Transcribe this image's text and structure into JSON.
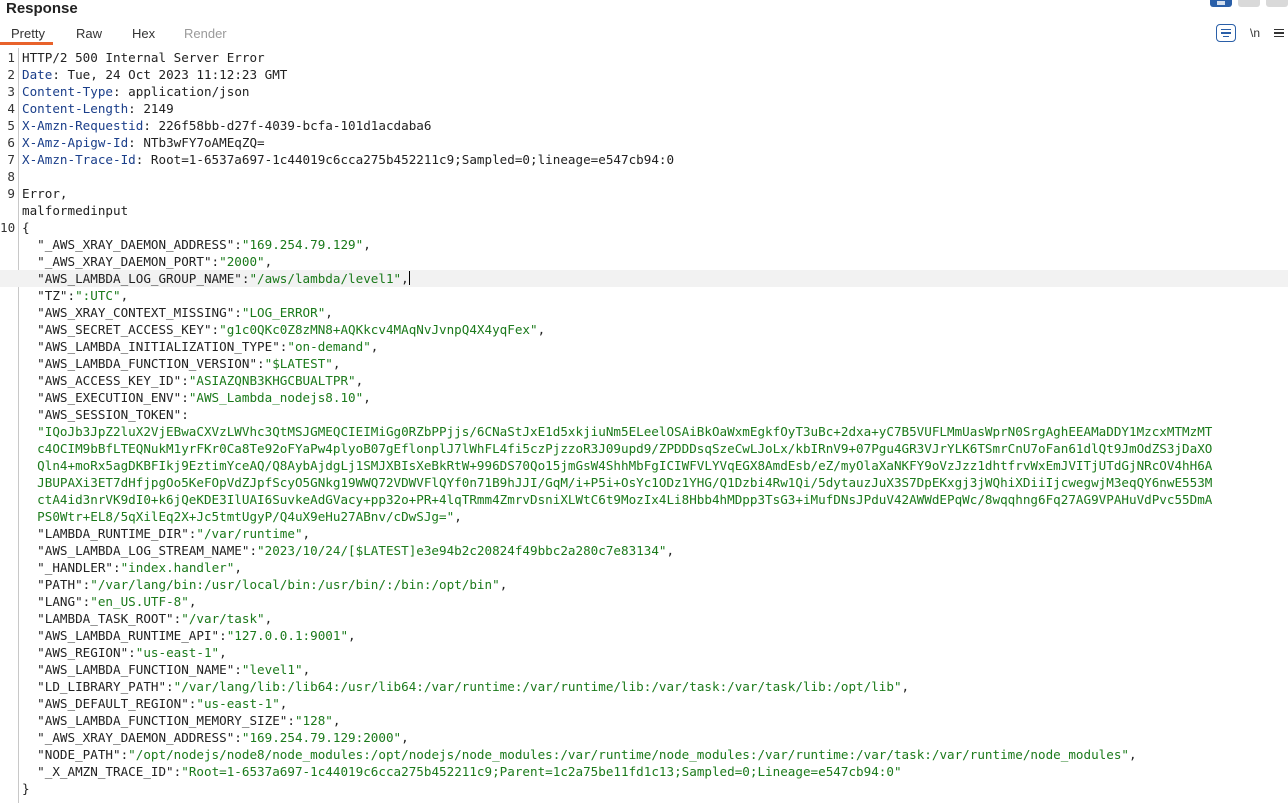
{
  "panel": {
    "title": "Response",
    "tabs": [
      "Pretty",
      "Raw",
      "Hex",
      "Render"
    ],
    "tools": {
      "wrap_icon": "wrap-lines-icon",
      "newline_label": "\\n",
      "menu_icon": "hamburger-menu-icon"
    }
  },
  "lines": [
    {
      "n": "1",
      "parts": [
        {
          "c": "v",
          "t": "HTTP/2 500 Internal Server Error"
        }
      ]
    },
    {
      "n": "2",
      "parts": [
        {
          "c": "k",
          "t": "Date"
        },
        {
          "c": "v",
          "t": ": Tue, 24 Oct 2023 11:12:23 GMT"
        }
      ]
    },
    {
      "n": "3",
      "parts": [
        {
          "c": "k",
          "t": "Content-Type"
        },
        {
          "c": "v",
          "t": ": application/json"
        }
      ]
    },
    {
      "n": "4",
      "parts": [
        {
          "c": "k",
          "t": "Content-Length"
        },
        {
          "c": "v",
          "t": ": 2149"
        }
      ]
    },
    {
      "n": "5",
      "parts": [
        {
          "c": "k",
          "t": "X-Amzn-Requestid"
        },
        {
          "c": "v",
          "t": ": 226f58bb-d27f-4039-bcfa-101d1acdaba6"
        }
      ]
    },
    {
      "n": "6",
      "parts": [
        {
          "c": "k",
          "t": "X-Amz-Apigw-Id"
        },
        {
          "c": "v",
          "t": ": NTb3wFY7oAMEqZQ="
        }
      ]
    },
    {
      "n": "7",
      "parts": [
        {
          "c": "k",
          "t": "X-Amzn-Trace-Id"
        },
        {
          "c": "v",
          "t": ": Root=1-6537a697-1c44019c6cca275b452211c9;Sampled=0;lineage=e547cb94:0"
        }
      ]
    },
    {
      "n": "8",
      "parts": []
    },
    {
      "n": "9",
      "parts": [
        {
          "c": "v",
          "t": "Error,"
        }
      ]
    },
    {
      "n": "",
      "parts": [
        {
          "c": "v",
          "t": "malformedinput"
        }
      ]
    },
    {
      "n": "10",
      "parts": [
        {
          "c": "p",
          "t": "{"
        }
      ]
    },
    {
      "n": "",
      "parts": [
        {
          "c": "p",
          "t": "  \"_AWS_XRAY_DAEMON_ADDRESS\":"
        },
        {
          "c": "s",
          "t": "\"169.254.79.129\""
        },
        {
          "c": "p",
          "t": ","
        }
      ]
    },
    {
      "n": "",
      "parts": [
        {
          "c": "p",
          "t": "  \"_AWS_XRAY_DAEMON_PORT\":"
        },
        {
          "c": "s",
          "t": "\"2000\""
        },
        {
          "c": "p",
          "t": ","
        }
      ]
    },
    {
      "n": "",
      "hl": true,
      "cursor": true,
      "parts": [
        {
          "c": "p",
          "t": "  \"AWS_LAMBDA_LOG_GROUP_NAME\":"
        },
        {
          "c": "s",
          "t": "\"/aws/lambda/level1\""
        },
        {
          "c": "p",
          "t": ","
        }
      ]
    },
    {
      "n": "",
      "parts": [
        {
          "c": "p",
          "t": "  \"TZ\":"
        },
        {
          "c": "s",
          "t": "\":UTC\""
        },
        {
          "c": "p",
          "t": ","
        }
      ]
    },
    {
      "n": "",
      "parts": [
        {
          "c": "p",
          "t": "  \"AWS_XRAY_CONTEXT_MISSING\":"
        },
        {
          "c": "s",
          "t": "\"LOG_ERROR\""
        },
        {
          "c": "p",
          "t": ","
        }
      ]
    },
    {
      "n": "",
      "parts": [
        {
          "c": "p",
          "t": "  \"AWS_SECRET_ACCESS_KEY\":"
        },
        {
          "c": "s",
          "t": "\"g1c0QKc0Z8zMN8+AQKkcv4MAqNvJvnpQ4X4yqFex\""
        },
        {
          "c": "p",
          "t": ","
        }
      ]
    },
    {
      "n": "",
      "parts": [
        {
          "c": "p",
          "t": "  \"AWS_LAMBDA_INITIALIZATION_TYPE\":"
        },
        {
          "c": "s",
          "t": "\"on-demand\""
        },
        {
          "c": "p",
          "t": ","
        }
      ]
    },
    {
      "n": "",
      "parts": [
        {
          "c": "p",
          "t": "  \"AWS_LAMBDA_FUNCTION_VERSION\":"
        },
        {
          "c": "s",
          "t": "\"$LATEST\""
        },
        {
          "c": "p",
          "t": ","
        }
      ]
    },
    {
      "n": "",
      "parts": [
        {
          "c": "p",
          "t": "  \"AWS_ACCESS_KEY_ID\":"
        },
        {
          "c": "s",
          "t": "\"ASIAZQNB3KHGCBUALTPR\""
        },
        {
          "c": "p",
          "t": ","
        }
      ]
    },
    {
      "n": "",
      "parts": [
        {
          "c": "p",
          "t": "  \"AWS_EXECUTION_ENV\":"
        },
        {
          "c": "s",
          "t": "\"AWS_Lambda_nodejs8.10\""
        },
        {
          "c": "p",
          "t": ","
        }
      ]
    },
    {
      "n": "",
      "parts": [
        {
          "c": "p",
          "t": "  \"AWS_SESSION_TOKEN\":"
        }
      ]
    },
    {
      "n": "",
      "parts": [
        {
          "c": "s",
          "t": "  \"IQoJb3JpZ2luX2VjEBwaCXVzLWVhc3QtMSJGMEQCIEIMiGg0RZbPPjjs/6CNaStJxE1d5xkjiuNm5ELeelOSAiBkOaWxmEgkfOyT3uBc+2dxa+yC7B5VUFLMmUasWprN0SrgAghEEAMaDDY1MzcxMTMzMT"
        }
      ]
    },
    {
      "n": "",
      "parts": [
        {
          "c": "s",
          "t": "  c4OCIM9bBfLTEQNukM1yrFKr0Ca8Te92oFYaPw4plyoB07gEflonplJ7lWhFL4fi5czPjzzoR3J09upd9/ZPDDDsqSzeCwLJoLx/kbIRnV9+07Pgu4GR3VJrYLK6TSmrCnU7oFan61dlQt9JmOdZS3jDaXO"
        }
      ]
    },
    {
      "n": "",
      "parts": [
        {
          "c": "s",
          "t": "  Qln4+moRx5agDKBFIkj9EztimYceAQ/Q8AybAjdgLj1SMJXBIsXeBkRtW+996DS70Qo15jmGsW4ShhMbFgICIWFVLYVqEGX8AmdEsb/eZ/myOlaXaNKFY9oVzJzz1dhtfrvWxEmJVITjUTdGjNRcOV4hH6A"
        }
      ]
    },
    {
      "n": "",
      "parts": [
        {
          "c": "s",
          "t": "  JBUPAXi3ET7dHfjpgOo5KeFOpVdZJpfScyO5GNkg19WWQ72VDWVFlQYf0n71B9hJJI/GqM/i+P5i+OsYc1ODz1YHG/Q1Dzbi4Rw1Qi/5dytauzJuX3S7DpEKxgj3jWQhiXDiiIjcwegwjM3eqQY6nwE553M"
        }
      ]
    },
    {
      "n": "",
      "parts": [
        {
          "c": "s",
          "t": "  ctA4id3nrVK9dI0+k6jQeKDE3IlUAI6SuvkeAdGVacy+pp32o+PR+4lqTRmm4ZmrvDsniXLWtC6t9MozIx4Li8Hbb4hMDpp3TsG3+iMufDNsJPduV42AWWdEPqWc/8wqqhng6Fq27AG9VPAHuVdPvc55DmA"
        }
      ]
    },
    {
      "n": "",
      "parts": [
        {
          "c": "s",
          "t": "  PS0Wtr+EL8/5qXilEq2X+Jc5tmtUgyP/Q4uX9eHu27ABnv/cDwSJg=\""
        },
        {
          "c": "p",
          "t": ","
        }
      ]
    },
    {
      "n": "",
      "parts": [
        {
          "c": "p",
          "t": "  \"LAMBDA_RUNTIME_DIR\":"
        },
        {
          "c": "s",
          "t": "\"/var/runtime\""
        },
        {
          "c": "p",
          "t": ","
        }
      ]
    },
    {
      "n": "",
      "parts": [
        {
          "c": "p",
          "t": "  \"AWS_LAMBDA_LOG_STREAM_NAME\":"
        },
        {
          "c": "s",
          "t": "\"2023/10/24/[$LATEST]e3e94b2c20824f49bbc2a280c7e83134\""
        },
        {
          "c": "p",
          "t": ","
        }
      ]
    },
    {
      "n": "",
      "parts": [
        {
          "c": "p",
          "t": "  \"_HANDLER\":"
        },
        {
          "c": "s",
          "t": "\"index.handler\""
        },
        {
          "c": "p",
          "t": ","
        }
      ]
    },
    {
      "n": "",
      "parts": [
        {
          "c": "p",
          "t": "  \"PATH\":"
        },
        {
          "c": "s",
          "t": "\"/var/lang/bin:/usr/local/bin:/usr/bin/:/bin:/opt/bin\""
        },
        {
          "c": "p",
          "t": ","
        }
      ]
    },
    {
      "n": "",
      "parts": [
        {
          "c": "p",
          "t": "  \"LANG\":"
        },
        {
          "c": "s",
          "t": "\"en_US.UTF-8\""
        },
        {
          "c": "p",
          "t": ","
        }
      ]
    },
    {
      "n": "",
      "parts": [
        {
          "c": "p",
          "t": "  \"LAMBDA_TASK_ROOT\":"
        },
        {
          "c": "s",
          "t": "\"/var/task\""
        },
        {
          "c": "p",
          "t": ","
        }
      ]
    },
    {
      "n": "",
      "parts": [
        {
          "c": "p",
          "t": "  \"AWS_LAMBDA_RUNTIME_API\":"
        },
        {
          "c": "s",
          "t": "\"127.0.0.1:9001\""
        },
        {
          "c": "p",
          "t": ","
        }
      ]
    },
    {
      "n": "",
      "parts": [
        {
          "c": "p",
          "t": "  \"AWS_REGION\":"
        },
        {
          "c": "s",
          "t": "\"us-east-1\""
        },
        {
          "c": "p",
          "t": ","
        }
      ]
    },
    {
      "n": "",
      "parts": [
        {
          "c": "p",
          "t": "  \"AWS_LAMBDA_FUNCTION_NAME\":"
        },
        {
          "c": "s",
          "t": "\"level1\""
        },
        {
          "c": "p",
          "t": ","
        }
      ]
    },
    {
      "n": "",
      "parts": [
        {
          "c": "p",
          "t": "  \"LD_LIBRARY_PATH\":"
        },
        {
          "c": "s",
          "t": "\"/var/lang/lib:/lib64:/usr/lib64:/var/runtime:/var/runtime/lib:/var/task:/var/task/lib:/opt/lib\""
        },
        {
          "c": "p",
          "t": ","
        }
      ]
    },
    {
      "n": "",
      "parts": [
        {
          "c": "p",
          "t": "  \"AWS_DEFAULT_REGION\":"
        },
        {
          "c": "s",
          "t": "\"us-east-1\""
        },
        {
          "c": "p",
          "t": ","
        }
      ]
    },
    {
      "n": "",
      "parts": [
        {
          "c": "p",
          "t": "  \"AWS_LAMBDA_FUNCTION_MEMORY_SIZE\":"
        },
        {
          "c": "s",
          "t": "\"128\""
        },
        {
          "c": "p",
          "t": ","
        }
      ]
    },
    {
      "n": "",
      "parts": [
        {
          "c": "p",
          "t": "  \"_AWS_XRAY_DAEMON_ADDRESS\":"
        },
        {
          "c": "s",
          "t": "\"169.254.79.129:2000\""
        },
        {
          "c": "p",
          "t": ","
        }
      ]
    },
    {
      "n": "",
      "parts": [
        {
          "c": "p",
          "t": "  \"NODE_PATH\":"
        },
        {
          "c": "s",
          "t": "\"/opt/nodejs/node8/node_modules:/opt/nodejs/node_modules:/var/runtime/node_modules:/var/runtime:/var/task:/var/runtime/node_modules\""
        },
        {
          "c": "p",
          "t": ","
        }
      ]
    },
    {
      "n": "",
      "parts": [
        {
          "c": "p",
          "t": "  \"_X_AMZN_TRACE_ID\":"
        },
        {
          "c": "s",
          "t": "\"Root=1-6537a697-1c44019c6cca275b452211c9;Parent=1c2a75be11fd1c13;Sampled=0;Lineage=e547cb94:0\""
        }
      ]
    },
    {
      "n": "",
      "parts": [
        {
          "c": "p",
          "t": "}"
        }
      ]
    }
  ]
}
